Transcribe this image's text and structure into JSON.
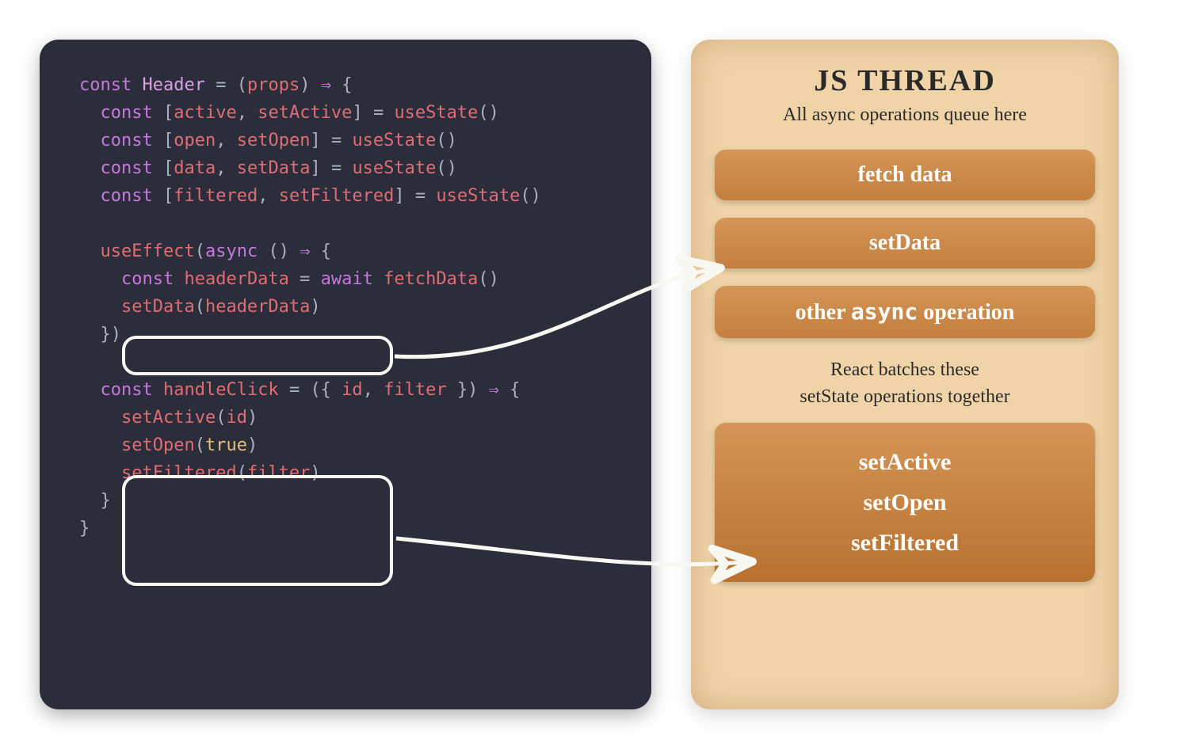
{
  "code": {
    "lines": [
      {
        "pre": "",
        "tokens": [
          [
            "kw",
            "const"
          ],
          [
            "",
            " "
          ],
          [
            "fn",
            "Header"
          ],
          [
            "",
            " "
          ],
          [
            "brace",
            "="
          ],
          [
            "",
            " "
          ],
          [
            "brace",
            "("
          ],
          [
            "var",
            "props"
          ],
          [
            "brace",
            ")"
          ],
          [
            "",
            " "
          ],
          [
            "arrow",
            "⇒"
          ],
          [
            "",
            " "
          ],
          [
            "brace",
            "{"
          ]
        ]
      },
      {
        "pre": "  ",
        "tokens": [
          [
            "kw",
            "const"
          ],
          [
            "",
            " "
          ],
          [
            "brace",
            "["
          ],
          [
            "var",
            "active"
          ],
          [
            "brace",
            ","
          ],
          [
            "",
            " "
          ],
          [
            "var",
            "setActive"
          ],
          [
            "brace",
            "]"
          ],
          [
            "",
            " "
          ],
          [
            "brace",
            "="
          ],
          [
            "",
            " "
          ],
          [
            "call",
            "useState"
          ],
          [
            "brace",
            "()"
          ]
        ]
      },
      {
        "pre": "  ",
        "tokens": [
          [
            "kw",
            "const"
          ],
          [
            "",
            " "
          ],
          [
            "brace",
            "["
          ],
          [
            "var",
            "open"
          ],
          [
            "brace",
            ","
          ],
          [
            "",
            " "
          ],
          [
            "var",
            "setOpen"
          ],
          [
            "brace",
            "]"
          ],
          [
            "",
            " "
          ],
          [
            "brace",
            "="
          ],
          [
            "",
            " "
          ],
          [
            "call",
            "useState"
          ],
          [
            "brace",
            "()"
          ]
        ]
      },
      {
        "pre": "  ",
        "tokens": [
          [
            "kw",
            "const"
          ],
          [
            "",
            " "
          ],
          [
            "brace",
            "["
          ],
          [
            "var",
            "data"
          ],
          [
            "brace",
            ","
          ],
          [
            "",
            " "
          ],
          [
            "var",
            "setData"
          ],
          [
            "brace",
            "]"
          ],
          [
            "",
            " "
          ],
          [
            "brace",
            "="
          ],
          [
            "",
            " "
          ],
          [
            "call",
            "useState"
          ],
          [
            "brace",
            "()"
          ]
        ]
      },
      {
        "pre": "  ",
        "tokens": [
          [
            "kw",
            "const"
          ],
          [
            "",
            " "
          ],
          [
            "brace",
            "["
          ],
          [
            "var",
            "filtered"
          ],
          [
            "brace",
            ","
          ],
          [
            "",
            " "
          ],
          [
            "var",
            "setFiltered"
          ],
          [
            "brace",
            "]"
          ],
          [
            "",
            " "
          ],
          [
            "brace",
            "="
          ],
          [
            "",
            " "
          ],
          [
            "call",
            "useState"
          ],
          [
            "brace",
            "()"
          ]
        ]
      },
      {
        "pre": "",
        "tokens": [
          [
            "",
            ""
          ]
        ]
      },
      {
        "pre": "  ",
        "tokens": [
          [
            "call",
            "useEffect"
          ],
          [
            "brace",
            "("
          ],
          [
            "kw",
            "async"
          ],
          [
            "",
            " "
          ],
          [
            "brace",
            "()"
          ],
          [
            "",
            " "
          ],
          [
            "arrow",
            "⇒"
          ],
          [
            "",
            " "
          ],
          [
            "brace",
            "{"
          ]
        ]
      },
      {
        "pre": "    ",
        "tokens": [
          [
            "kw",
            "const"
          ],
          [
            "",
            " "
          ],
          [
            "var",
            "headerData"
          ],
          [
            "",
            " "
          ],
          [
            "brace",
            "="
          ],
          [
            "",
            " "
          ],
          [
            "kw",
            "await"
          ],
          [
            "",
            " "
          ],
          [
            "call",
            "fetchData"
          ],
          [
            "brace",
            "()"
          ]
        ]
      },
      {
        "pre": "    ",
        "tokens": [
          [
            "call",
            "setData"
          ],
          [
            "brace",
            "("
          ],
          [
            "var",
            "headerData"
          ],
          [
            "brace",
            ")"
          ]
        ]
      },
      {
        "pre": "  ",
        "tokens": [
          [
            "brace",
            "})"
          ]
        ]
      },
      {
        "pre": "",
        "tokens": [
          [
            "",
            ""
          ]
        ]
      },
      {
        "pre": "  ",
        "tokens": [
          [
            "kw",
            "const"
          ],
          [
            "",
            " "
          ],
          [
            "var",
            "handleClick"
          ],
          [
            "",
            " "
          ],
          [
            "brace",
            "="
          ],
          [
            "",
            " "
          ],
          [
            "brace",
            "({"
          ],
          [
            "",
            " "
          ],
          [
            "var",
            "id"
          ],
          [
            "brace",
            ","
          ],
          [
            "",
            " "
          ],
          [
            "var",
            "filter"
          ],
          [
            "",
            " "
          ],
          [
            "brace",
            "})"
          ],
          [
            "",
            " "
          ],
          [
            "arrow",
            "⇒"
          ],
          [
            "",
            " "
          ],
          [
            "brace",
            "{"
          ]
        ]
      },
      {
        "pre": "    ",
        "tokens": [
          [
            "call",
            "setActive"
          ],
          [
            "brace",
            "("
          ],
          [
            "var",
            "id"
          ],
          [
            "brace",
            ")"
          ]
        ]
      },
      {
        "pre": "    ",
        "tokens": [
          [
            "call",
            "setOpen"
          ],
          [
            "brace",
            "("
          ],
          [
            "str",
            "true"
          ],
          [
            "brace",
            ")"
          ]
        ]
      },
      {
        "pre": "    ",
        "tokens": [
          [
            "call",
            "setFiltered"
          ],
          [
            "brace",
            "("
          ],
          [
            "var",
            "filter"
          ],
          [
            "brace",
            ")"
          ]
        ]
      },
      {
        "pre": "  ",
        "tokens": [
          [
            "brace",
            "}"
          ]
        ]
      },
      {
        "pre": "",
        "tokens": [
          [
            "brace",
            "}"
          ]
        ]
      }
    ]
  },
  "thread": {
    "title": "JS THREAD",
    "subtitle": "All async operations queue here",
    "items": [
      {
        "label": "fetch data"
      },
      {
        "label": "setData"
      },
      {
        "label_html": "other <span class='mono-inline'>async</span> operation"
      }
    ],
    "batch_label": "React batches these\nsetState operations together",
    "batch": [
      "setActive",
      "setOpen",
      "setFiltered"
    ]
  },
  "colors": {
    "bg_code": "#2b2d3a",
    "bg_thread": "#f0d4a8",
    "queue_item": "#c47f3e",
    "arrow": "#f8f8f2"
  }
}
